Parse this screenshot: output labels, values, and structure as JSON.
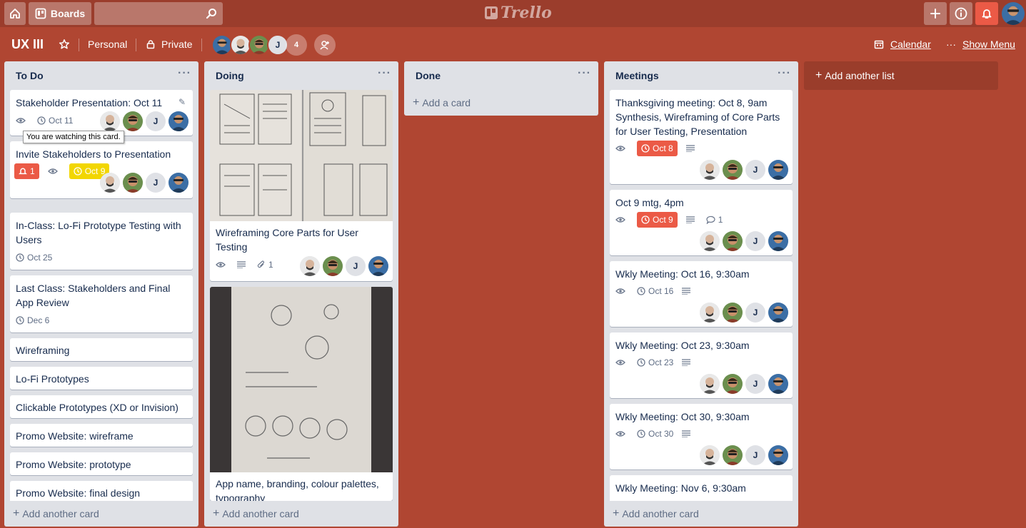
{
  "header": {
    "boards_label": "Boards",
    "logo_text": "Trello"
  },
  "board": {
    "title": "UX III",
    "team": "Personal",
    "visibility": "Private",
    "member_count": "4",
    "calendar_label": "Calendar",
    "menu_label": "Show Menu"
  },
  "avatar_initial": "J",
  "tooltip": "You are watching this card.",
  "add_list_label": "Add another list",
  "lists": {
    "todo": {
      "title": "To Do",
      "add_card": "Add another card",
      "cards": [
        {
          "title": "Stakeholder Presentation: Oct 11",
          "due": "Oct 11"
        },
        {
          "title": "Invite Stakeholders to Presentation",
          "notifications": "1",
          "due": "Oct 9"
        },
        {
          "title": "In-Class: Lo-Fi Prototype Testing with Users",
          "due": "Oct 25"
        },
        {
          "title": "Last Class: Stakeholders and Final App Review",
          "due": "Dec 6"
        },
        {
          "title": "Wireframing"
        },
        {
          "title": "Lo-Fi Prototypes"
        },
        {
          "title": "Clickable Prototypes (XD or Invision)"
        },
        {
          "title": "Promo Website: wireframe"
        },
        {
          "title": "Promo Website: prototype"
        },
        {
          "title": "Promo Website: final design"
        }
      ]
    },
    "doing": {
      "title": "Doing",
      "add_card": "Add another card",
      "cards": [
        {
          "title": "Wireframing Core Parts for User Testing",
          "attachments": "1"
        },
        {
          "title": "App name, branding, colour palettes, typography"
        }
      ]
    },
    "done": {
      "title": "Done",
      "add_card": "Add a card"
    },
    "meetings": {
      "title": "Meetings",
      "add_card": "Add another card",
      "cards": [
        {
          "title": "Thanksgiving meeting: Oct 8, 9am Synthesis, Wireframing of Core Parts for User Testing, Presentation",
          "due": "Oct 8"
        },
        {
          "title": "Oct 9 mtg, 4pm",
          "due": "Oct 9",
          "comments": "1"
        },
        {
          "title": "Wkly Meeting: Oct 16, 9:30am",
          "due": "Oct 16"
        },
        {
          "title": "Wkly Meeting: Oct 23, 9:30am",
          "due": "Oct 23"
        },
        {
          "title": "Wkly Meeting: Oct 30, 9:30am",
          "due": "Oct 30"
        },
        {
          "title": "Wkly Meeting: Nov 6, 9:30am"
        }
      ]
    }
  },
  "colors": {
    "board_bg": "#b04632",
    "header_bg": "#9b3d2c",
    "due_overdue": "#eb5a46",
    "due_soon": "#f2d600"
  }
}
